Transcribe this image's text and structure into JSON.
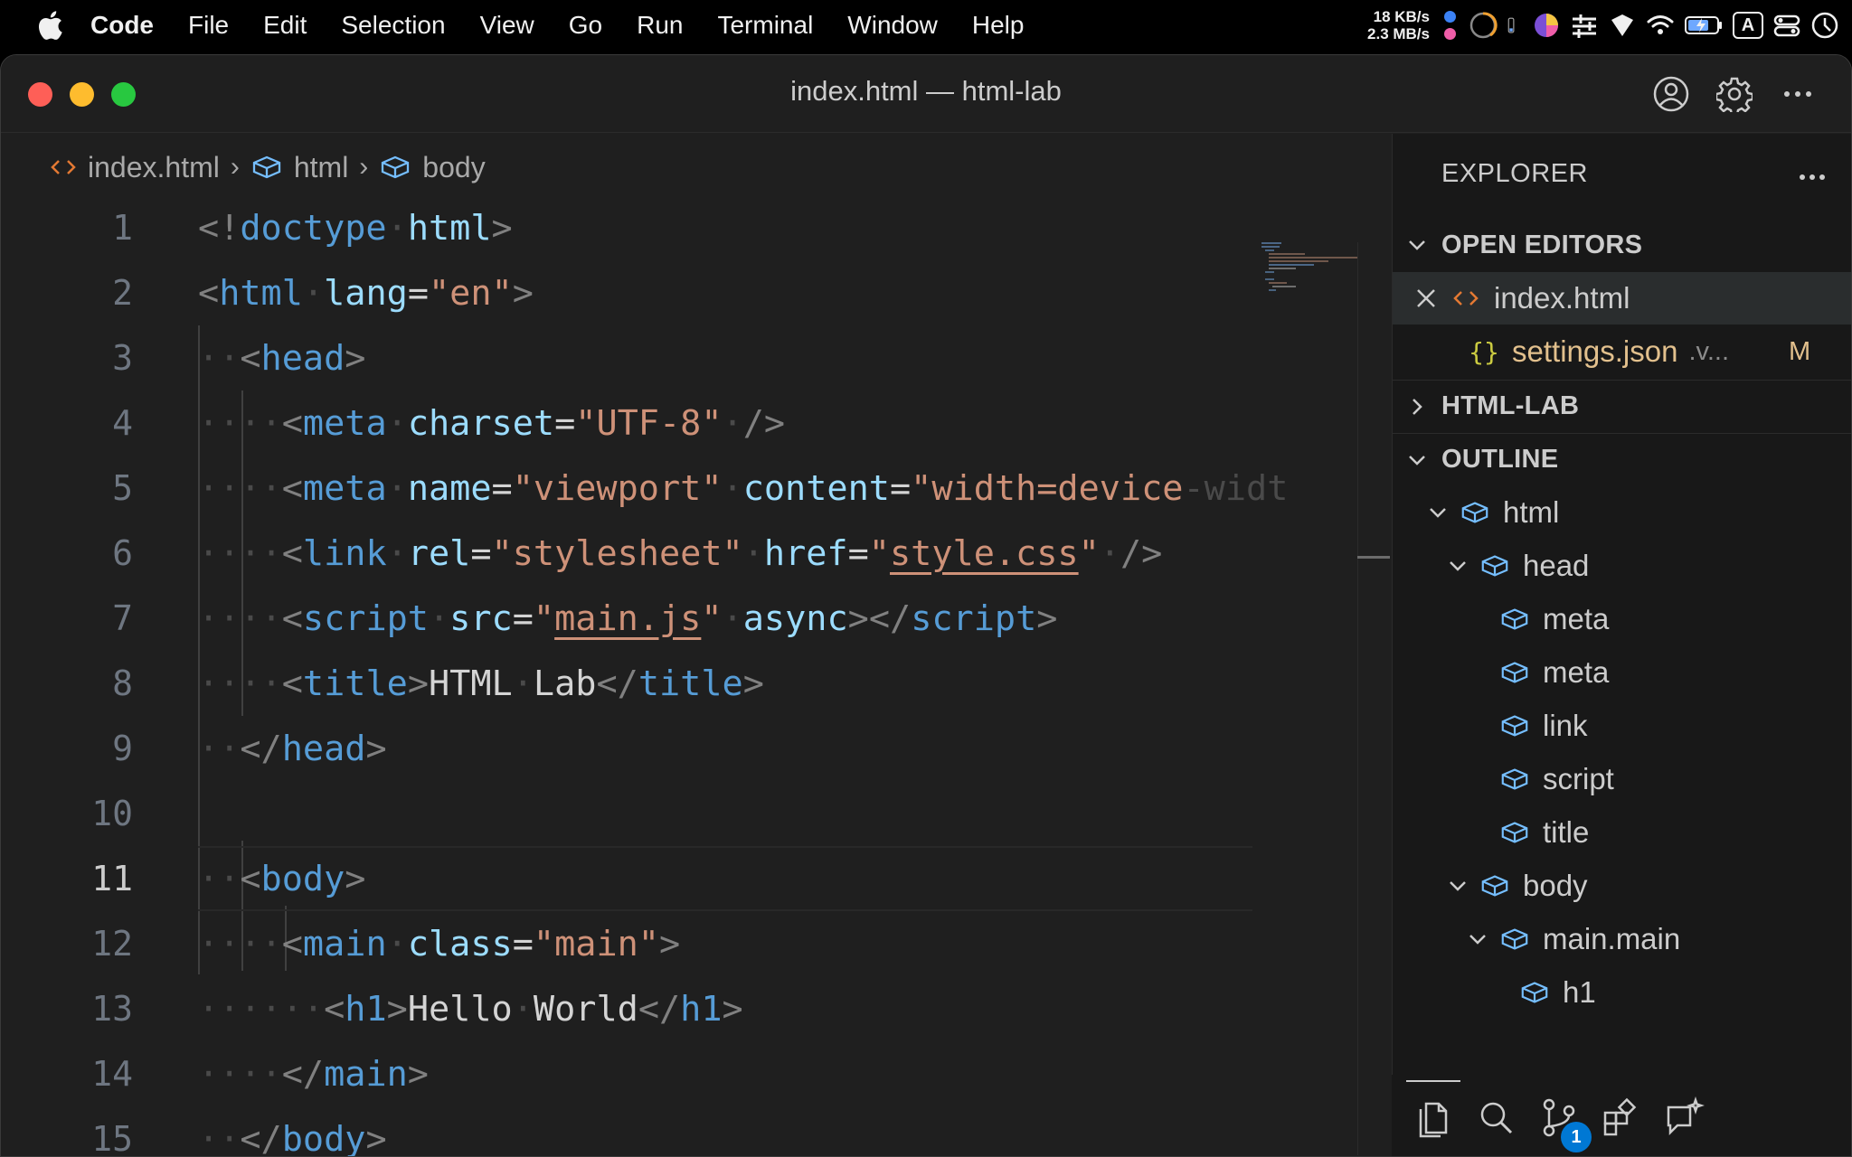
{
  "menubar": {
    "app_name": "Code",
    "menus": [
      "File",
      "Edit",
      "Selection",
      "View",
      "Go",
      "Run",
      "Terminal",
      "Window",
      "Help"
    ],
    "net_up": "18 KB/s",
    "net_down": "2.3 MB/s",
    "dot_colors": [
      "#3b82f6",
      "#ef5da8"
    ],
    "input_source": "A"
  },
  "window": {
    "title": "index.html — html-lab",
    "traffic_colors": [
      "#fe5f57",
      "#febc2e",
      "#28c840"
    ]
  },
  "breadcrumb": {
    "file": "index.html",
    "item1": "html",
    "item2": "body"
  },
  "editor": {
    "active_line": 11,
    "line_numbers": [
      "1",
      "2",
      "3",
      "4",
      "5",
      "6",
      "7",
      "8",
      "9",
      "10",
      "11",
      "12",
      "13",
      "14",
      "15"
    ]
  },
  "sidebar": {
    "explorer_title": "EXPLORER",
    "open_editors_label": "OPEN EDITORS",
    "open_editors": [
      {
        "name": "index.html",
        "icon": "html-file-icon"
      },
      {
        "name": "settings.json",
        "suffix": ".v...",
        "badge": "M",
        "icon": "json-file-icon"
      }
    ],
    "workspace_label": "HTML-LAB",
    "outline_label": "OUTLINE",
    "outline": [
      {
        "label": "html",
        "expanded": true
      },
      {
        "label": "head",
        "expanded": true
      },
      {
        "label": "meta"
      },
      {
        "label": "meta"
      },
      {
        "label": "link"
      },
      {
        "label": "script"
      },
      {
        "label": "title"
      },
      {
        "label": "body",
        "expanded": true
      },
      {
        "label": "main.main",
        "expanded": true
      },
      {
        "label": "h1"
      }
    ]
  },
  "activity_bar": {
    "items": [
      "explorer-icon",
      "search-icon",
      "source-control-icon",
      "extensions-icon",
      "chat-icon"
    ],
    "scm_badge": "1"
  },
  "colors": {
    "tag": "#569cd6",
    "attribute": "#9cdcfe",
    "string": "#ce9178",
    "json_icon": "#cbcb41",
    "html_icon": "#e37933",
    "modified": "#e2c08d"
  }
}
